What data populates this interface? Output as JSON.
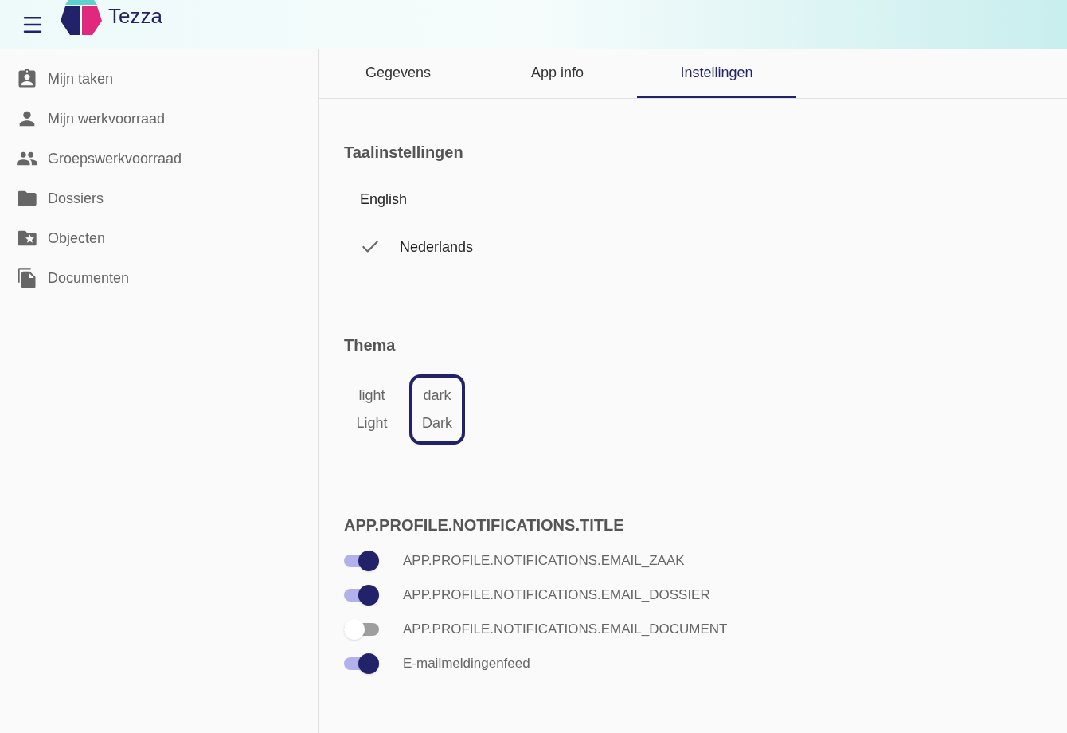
{
  "header": {
    "brand": "Tezza"
  },
  "sidebar": {
    "items": [
      {
        "label": "Mijn taken",
        "kind": "tasks"
      },
      {
        "label": "Mijn werkvoorraad",
        "kind": "person"
      },
      {
        "label": "Groepswerkvoorraad",
        "kind": "group"
      },
      {
        "label": "Dossiers",
        "kind": "folder"
      },
      {
        "label": "Objecten",
        "kind": "folder-pin"
      },
      {
        "label": "Documenten",
        "kind": "documents"
      }
    ]
  },
  "tabs": [
    {
      "label": "Gegevens",
      "selected": false
    },
    {
      "label": "App info",
      "selected": false
    },
    {
      "label": "Instellingen",
      "selected": true
    }
  ],
  "language": {
    "title": "Taalinstellingen",
    "options": [
      {
        "label": "English",
        "selected": false
      },
      {
        "label": "Nederlands",
        "selected": true
      }
    ]
  },
  "theme": {
    "title": "Thema",
    "options": [
      {
        "key": "light",
        "label": "Light",
        "selected": false
      },
      {
        "key": "dark",
        "label": "Dark",
        "selected": true
      }
    ]
  },
  "notifications": {
    "title": "APP.PROFILE.NOTIFICATIONS.TITLE",
    "items": [
      {
        "label": "APP.PROFILE.NOTIFICATIONS.EMAIL_ZAAK",
        "on": true
      },
      {
        "label": "APP.PROFILE.NOTIFICATIONS.EMAIL_DOSSIER",
        "on": true
      },
      {
        "label": "APP.PROFILE.NOTIFICATIONS.EMAIL_DOCUMENT",
        "on": false
      },
      {
        "label": "E-mailmeldingenfeed",
        "on": true
      }
    ]
  }
}
